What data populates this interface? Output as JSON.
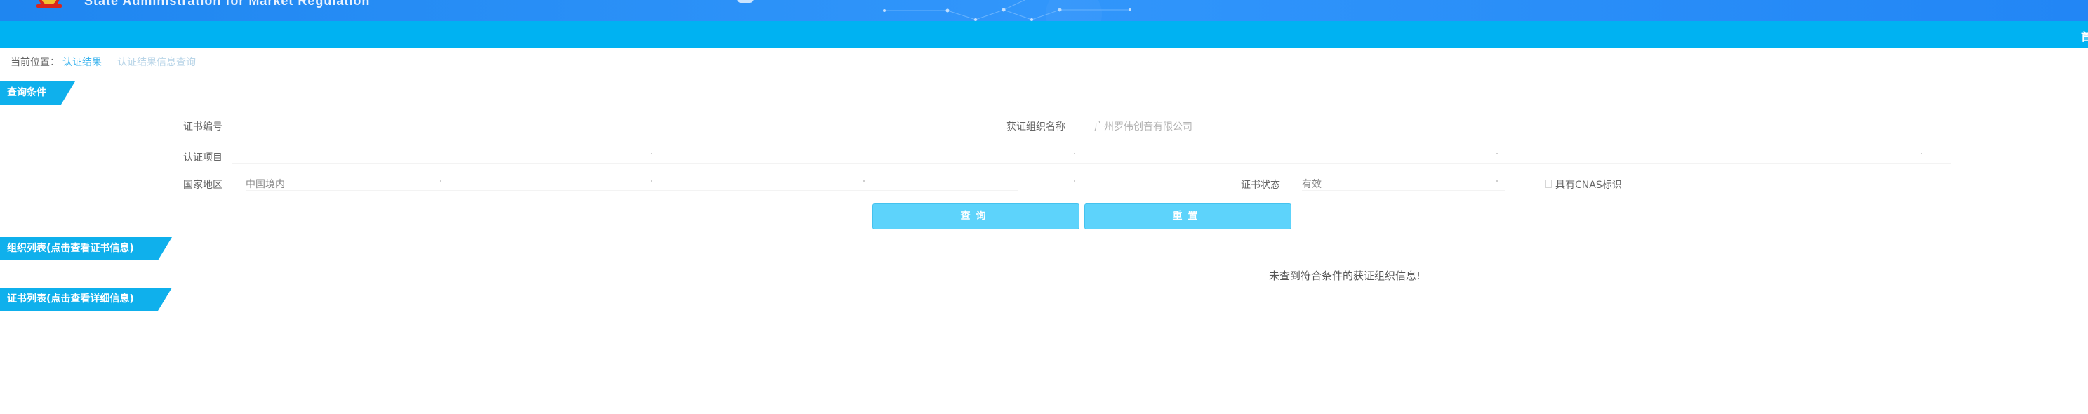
{
  "header": {
    "title": "State Administration for Market Regulation"
  },
  "nav": {
    "home_label": "首"
  },
  "breadcrumb": {
    "prefix": "当前位置：",
    "link": "认证结果",
    "current": "认证结果信息查询"
  },
  "sections": {
    "query_title": "查询条件",
    "org_list_title": "组织列表(点击查看证书信息)",
    "cert_list_title": "证书列表(点击查看详细信息)"
  },
  "form": {
    "cert_number_label": "证书编号",
    "cert_number_value": "",
    "org_name_label": "获证组织名称",
    "org_name_placeholder": "广州罗伟创音有限公司",
    "cert_project_label": "认证项目",
    "cert_project_value": "",
    "region_label": "国家地区",
    "region_value": "中国境内",
    "cert_status_label": "证书状态",
    "cert_status_value": "有效",
    "cnas_label": "具有CNAS标识",
    "cnas_checked": false
  },
  "buttons": {
    "query_label": "查询",
    "reset_label": "重置"
  },
  "results": {
    "empty_message": "未查到符合条件的获证组织信息!"
  },
  "colors": {
    "header_blue": "#2286f5",
    "nav_cyan": "#00b2f2",
    "section_tab": "#0fb0ec",
    "button_fill": "#5dd3fb"
  }
}
